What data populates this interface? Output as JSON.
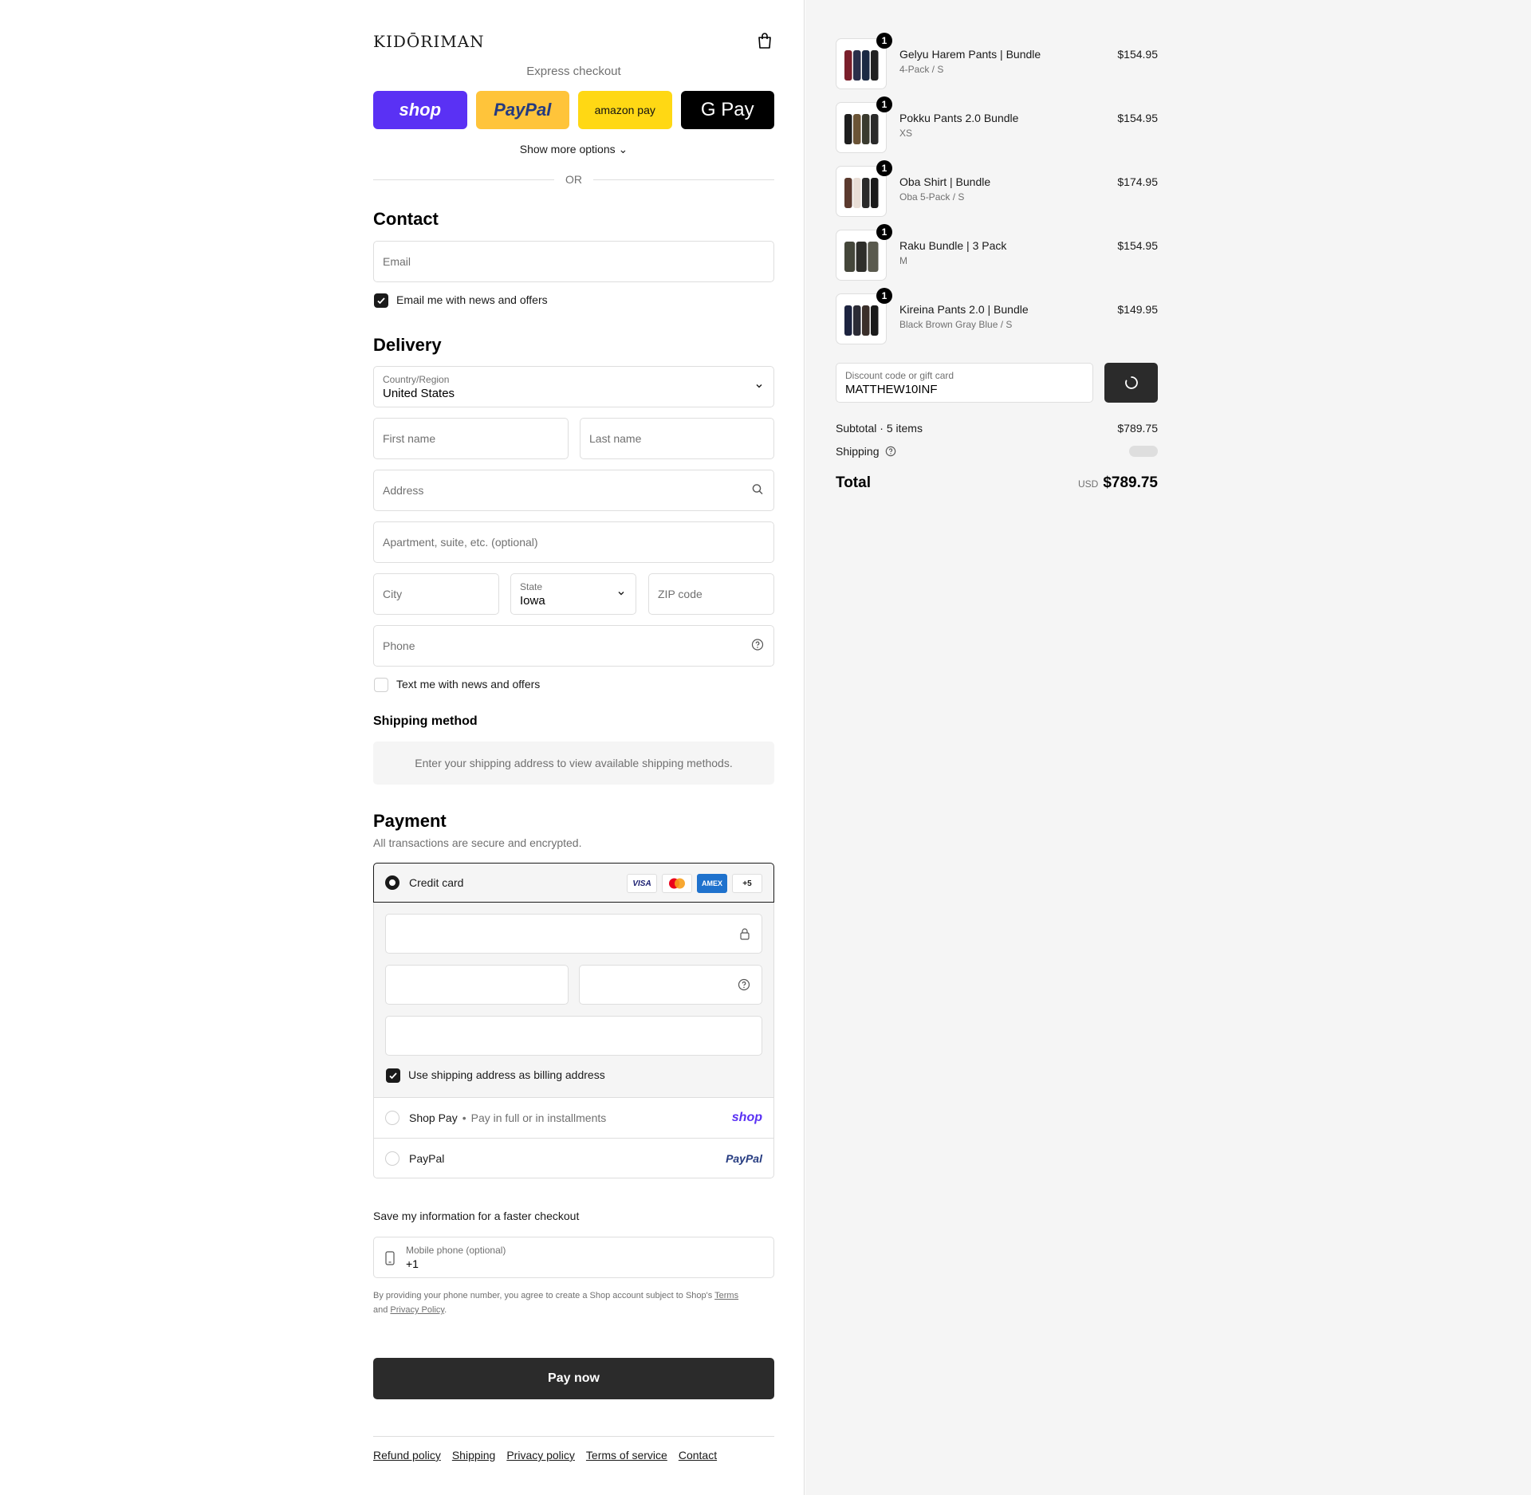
{
  "header": {
    "logo": "KIDŌRIMAN",
    "cart_icon": "bag-icon"
  },
  "express": {
    "label": "Express checkout",
    "buttons": [
      "shop",
      "PayPal",
      "amazon pay",
      "G Pay"
    ],
    "more": "Show more options",
    "or": "OR"
  },
  "contact": {
    "title": "Contact",
    "email_placeholder": "Email",
    "news_label": "Email me with news and offers"
  },
  "delivery": {
    "title": "Delivery",
    "country_label": "Country/Region",
    "country_value": "United States",
    "first_name": "First name",
    "last_name": "Last name",
    "address": "Address",
    "apartment": "Apartment, suite, etc. (optional)",
    "city": "City",
    "state_label": "State",
    "state_value": "Iowa",
    "zip": "ZIP code",
    "phone": "Phone",
    "text_label": "Text me with news and offers"
  },
  "shipping_method": {
    "title": "Shipping method",
    "message": "Enter your shipping address to view available shipping methods."
  },
  "payment": {
    "title": "Payment",
    "subtitle": "All transactions are secure and encrypted.",
    "credit_card": "Credit card",
    "cards": [
      "VISA",
      "",
      "AMEX",
      "+5"
    ],
    "billing_label": "Use shipping address as billing address",
    "shop_pay": "Shop Pay",
    "shop_pay_sub": "Pay in full or in installments",
    "shop_logo": "shop",
    "paypal": "PayPal",
    "paypal_logo": "PayPal"
  },
  "save": {
    "title": "Save my information for a faster checkout",
    "phone_label": "Mobile phone (optional)",
    "phone_value": "+1",
    "fine_prefix": "By providing your phone number, you agree to create a Shop account subject to Shop's ",
    "terms": "Terms",
    "and": "and",
    "privacy": "Privacy Policy",
    "period": "."
  },
  "pay_now": "Pay now",
  "footer": [
    "Refund policy",
    "Shipping",
    "Privacy policy",
    "Terms of service",
    "Contact"
  ],
  "order": {
    "items": [
      {
        "name": "Gelyu Harem Pants | Bundle",
        "variant": "4-Pack / S",
        "price": "$154.95",
        "qty": "1",
        "colors": [
          "#7a1f2b",
          "#2a2f4a",
          "#1b2a44",
          "#202020"
        ]
      },
      {
        "name": "Pokku Pants 2.0 Bundle",
        "variant": "XS",
        "price": "$154.95",
        "qty": "1",
        "colors": [
          "#1e1e1e",
          "#6b5436",
          "#3a3a2e",
          "#2a2a2a"
        ]
      },
      {
        "name": "Oba Shirt | Bundle",
        "variant": "Oba 5-Pack / S",
        "price": "$174.95",
        "qty": "1",
        "colors": [
          "#5b3a2e",
          "#e9ded6",
          "#2a2a2a",
          "#1a1a1a"
        ]
      },
      {
        "name": "Raku Bundle | 3 Pack",
        "variant": "M",
        "price": "$154.95",
        "qty": "1",
        "colors": [
          "#44463a",
          "#2e2e2a",
          "#5a5a4e"
        ]
      },
      {
        "name": "Kireina Pants 2.0 | Bundle",
        "variant": "Black Brown Gray Blue / S",
        "price": "$149.95",
        "qty": "1",
        "colors": [
          "#1d2440",
          "#2b2b35",
          "#3a2f2a",
          "#1a1a1a"
        ]
      }
    ],
    "discount_label": "Discount code or gift card",
    "discount_value": "MATTHEW10INF",
    "subtotal_label": "Subtotal · 5 items",
    "subtotal_value": "$789.75",
    "shipping_label": "Shipping",
    "total_label": "Total",
    "currency": "USD",
    "total_value": "$789.75"
  },
  "colors": {
    "shop": "#5a31f4",
    "paypal": "#ffc43a",
    "amazon": "#ffd814",
    "button_dark": "#2b2b2b"
  }
}
